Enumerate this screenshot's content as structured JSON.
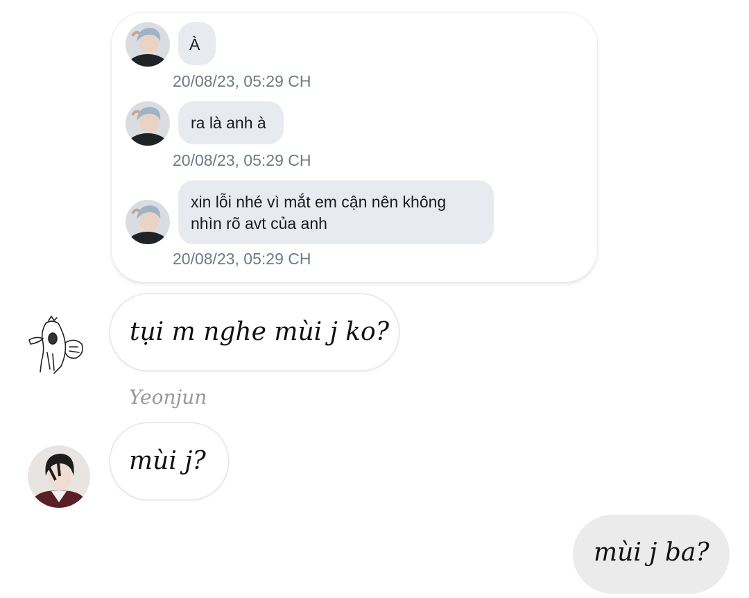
{
  "quoted_thread": {
    "messages": [
      {
        "text": "À",
        "time": "20/08/23, 05:29 CH"
      },
      {
        "text": "ra là anh à",
        "time": "20/08/23, 05:29 CH"
      },
      {
        "text_line1": "xin lỗi nhé vì mắt em cận nên không",
        "text_line2": "nhìn rõ avt của anh",
        "time": "20/08/23, 05:29 CH"
      }
    ]
  },
  "chat": {
    "msg1": {
      "text": "tụi m nghe mùi j ko?"
    },
    "msg2": {
      "sender": "Yeonjun",
      "text": "mùi j?"
    },
    "msg3": {
      "text": "mùi j ba?"
    }
  },
  "colors": {
    "quote_bubble": "#e7ebf0",
    "timestamp": "#6f7a84",
    "outgoing_bubble": "#ebebeb",
    "sender_name": "#9a9a9a"
  }
}
